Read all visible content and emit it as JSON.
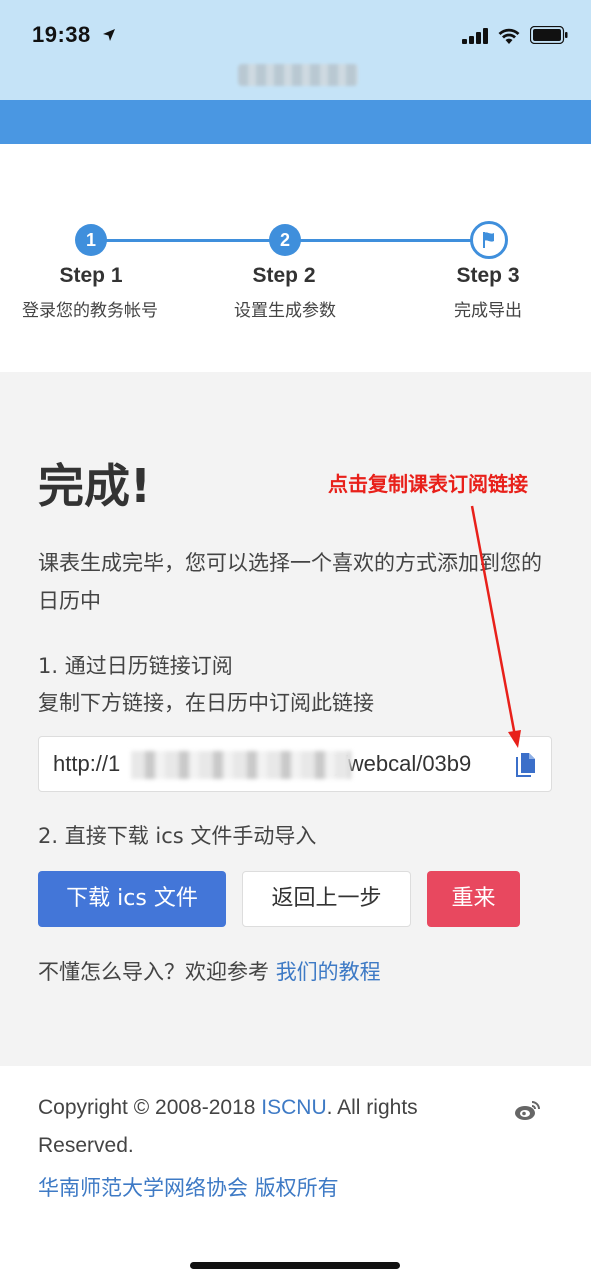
{
  "status_bar": {
    "time": "19:38"
  },
  "steps": [
    {
      "number": "1",
      "title": "Step 1",
      "desc": "登录您的教务帐号"
    },
    {
      "number": "2",
      "title": "Step 2",
      "desc": "设置生成参数"
    },
    {
      "title": "Step 3",
      "desc": "完成导出"
    }
  ],
  "main": {
    "title": "完成!",
    "annotation": "点击复制课表订阅链接",
    "intro": "课表生成完毕，您可以选择一个喜欢的方式添加到您的日历中",
    "method1_title": "1. 通过日历链接订阅",
    "method1_desc": "复制下方链接，在日历中订阅此链接",
    "link_prefix": "http://1",
    "link_suffix": ")/webcal/03b9",
    "method2_title": "2. 直接下载 ics 文件手动导入",
    "buttons": {
      "download": "下载 ics 文件",
      "back": "返回上一步",
      "reset": "重来"
    },
    "help_text": "不懂怎么导入？欢迎参考 ",
    "help_link": "我们的教程"
  },
  "footer": {
    "copyright_prefix": "Copyright © 2008-2018 ",
    "org_link": "ISCNU",
    "copyright_suffix": ". All rights",
    "copyright_line2": "Reserved.",
    "cn_copyright": "华南师范大学网络协会 版权所有"
  },
  "colors": {
    "primary": "#3f8fdc",
    "download_button": "#4376d8",
    "reset_button": "#e8485f",
    "annotation": "#e8201a",
    "link": "#3e7ac5"
  }
}
